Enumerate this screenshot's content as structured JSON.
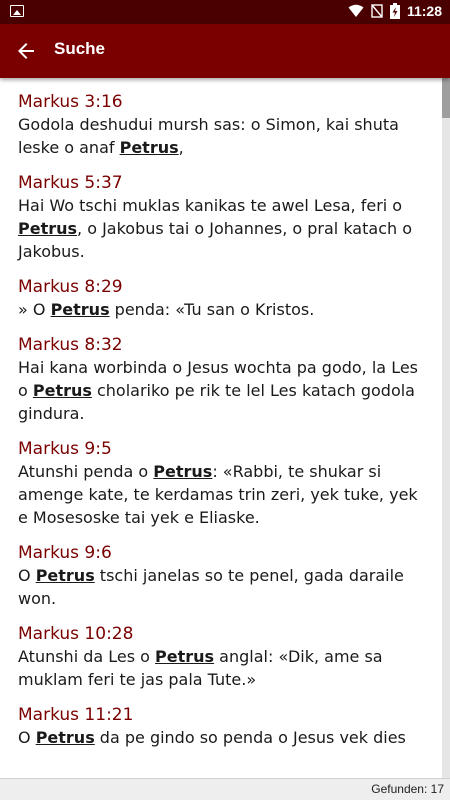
{
  "status_bar": {
    "time": "11:28",
    "icons": [
      "image-icon",
      "wifi-icon",
      "signal-off-icon",
      "battery-charging-icon"
    ]
  },
  "app_bar": {
    "back_icon": "arrow-back-icon",
    "title": "Suche"
  },
  "results": [
    {
      "ref": "Markus 3:16",
      "segments": [
        {
          "t": "Godola deshudui mursh sas: o Simon, kai shuta leske o anaf "
        },
        {
          "t": "Petrus",
          "hl": true
        },
        {
          "t": ","
        }
      ]
    },
    {
      "ref": "Markus 5:37",
      "segments": [
        {
          "t": "Hai Wo tschi muklas kanikas te awel Lesa, feri o "
        },
        {
          "t": "Petrus",
          "hl": true
        },
        {
          "t": ", o Jakobus tai o Johannes, o pral katach o Jakobus."
        }
      ]
    },
    {
      "ref": "Markus 8:29",
      "segments": [
        {
          "t": "» O "
        },
        {
          "t": "Petrus",
          "hl": true
        },
        {
          "t": " penda: «Tu san o Kristos."
        }
      ]
    },
    {
      "ref": "Markus 8:32",
      "segments": [
        {
          "t": "Hai kana worbinda o Jesus wochta pa godo, la Les o "
        },
        {
          "t": "Petrus",
          "hl": true
        },
        {
          "t": " cholariko pe rik te lel Les katach godola gindura."
        }
      ]
    },
    {
      "ref": "Markus 9:5",
      "segments": [
        {
          "t": "Atunshi penda o "
        },
        {
          "t": "Petrus",
          "hl": true
        },
        {
          "t": ": «Rabbi, te shukar si amenge kate, te kerdamas trin zeri, yek tuke, yek e Mosesoske tai yek e Eliaske."
        }
      ]
    },
    {
      "ref": "Markus 9:6",
      "segments": [
        {
          "t": "O "
        },
        {
          "t": "Petrus",
          "hl": true
        },
        {
          "t": " tschi janelas so te penel, gada daraile won."
        }
      ]
    },
    {
      "ref": "Markus 10:28",
      "segments": [
        {
          "t": "Atunshi da Les o "
        },
        {
          "t": "Petrus",
          "hl": true
        },
        {
          "t": " anglal: «Dik, ame sa muklam feri te jas pala Tute.»"
        }
      ]
    },
    {
      "ref": "Markus 11:21",
      "segments": [
        {
          "t": "O "
        },
        {
          "t": "Petrus",
          "hl": true
        },
        {
          "t": " da pe gindo so penda o Jesus vek dies"
        }
      ]
    }
  ],
  "footer": {
    "found_label": "Gefunden: 17"
  },
  "colors": {
    "status_bar": "#4a0000",
    "app_bar": "#7a0000",
    "reference": "#7a0000"
  }
}
